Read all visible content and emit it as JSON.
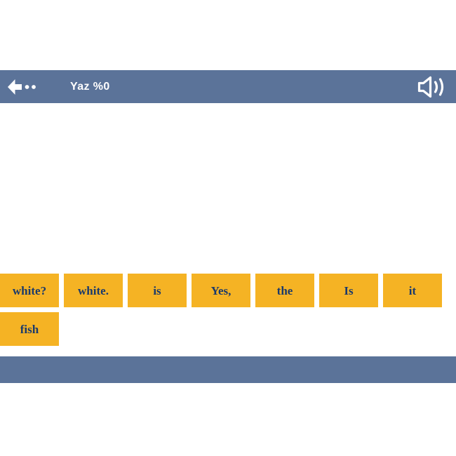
{
  "header": {
    "back_icon": "arrow-left-dots-icon",
    "title": "Yaz %0",
    "sound_icon": "speaker-volume-icon",
    "bar_color": "#5b7399",
    "text_color": "#ffffff"
  },
  "answer_area": {
    "placeholder": "",
    "background": "#ffffff"
  },
  "word_bank": {
    "tile_color": "#f5b324",
    "tile_text_color": "#1b3a6b",
    "tiles": [
      {
        "label": "white?"
      },
      {
        "label": "white."
      },
      {
        "label": "is"
      },
      {
        "label": "Yes,"
      },
      {
        "label": "the"
      },
      {
        "label": "Is"
      },
      {
        "label": "it"
      },
      {
        "label": "fish"
      }
    ]
  },
  "bottom_bar": {
    "label": "",
    "color": "#5b7399"
  }
}
